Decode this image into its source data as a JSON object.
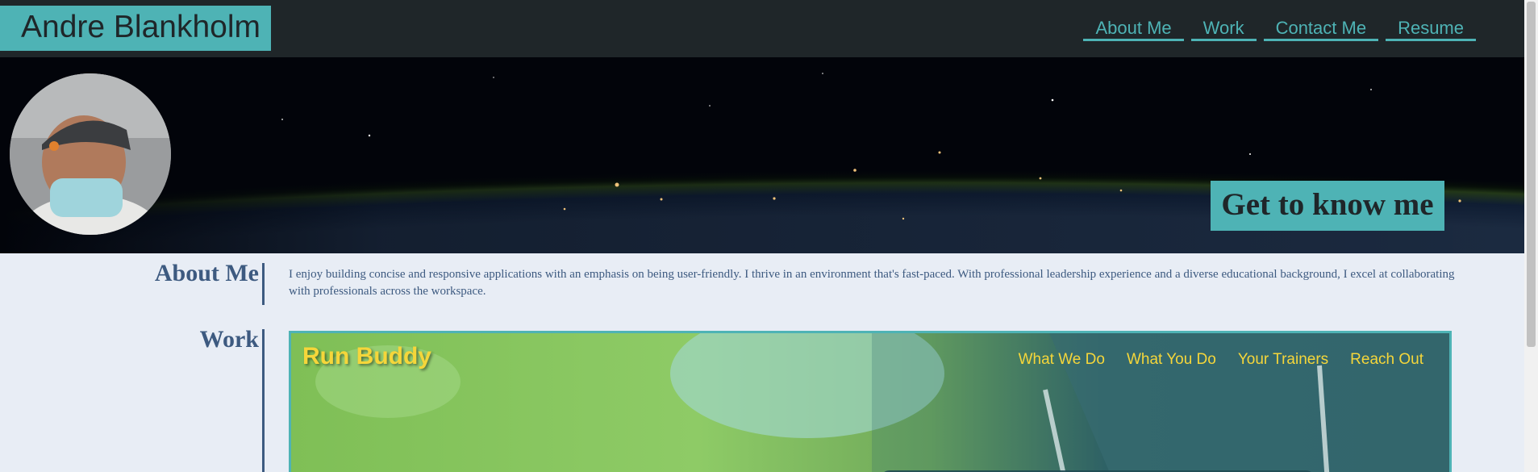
{
  "header": {
    "brand": "Andre Blankholm",
    "nav": [
      "About Me",
      "Work",
      "Contact Me",
      "Resume"
    ]
  },
  "hero": {
    "cta": "Get to know me",
    "avatar_alt": "profile photo"
  },
  "about": {
    "heading": "About Me",
    "text": "I enjoy building concise and responsive applications with an emphasis on being user-friendly. I thrive in an environment that's fast-paced. With professional leadership experience and a diverse educational background, I excel at collaborating with professionals across the workspace."
  },
  "work": {
    "heading": "Work",
    "project": {
      "title": "Run Buddy",
      "nav": [
        "What We Do",
        "What You Do",
        "Your Trainers",
        "Reach Out"
      ]
    }
  },
  "colors": {
    "accent": "#4eb3b5",
    "header_bg": "#1f2629",
    "page_bg": "#e8edf5",
    "text": "#3d5a80",
    "project_accent": "#f5d63a"
  }
}
